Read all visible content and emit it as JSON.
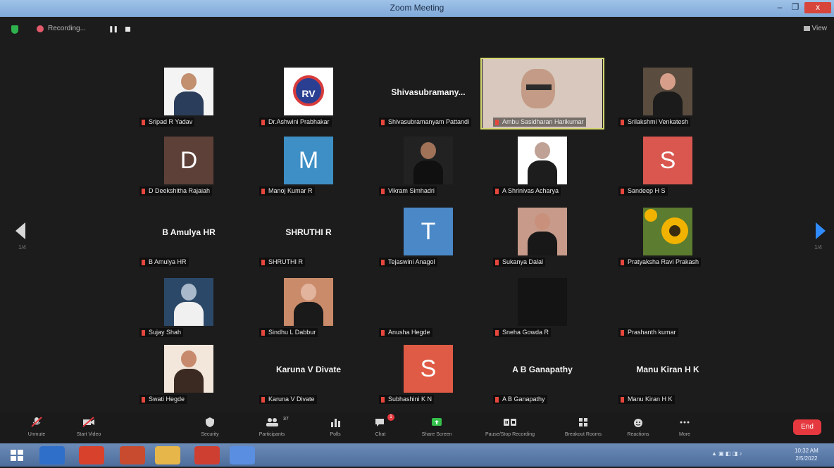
{
  "window": {
    "title": "Zoom Meeting",
    "min": "–",
    "max": "❐",
    "close": "x"
  },
  "topbar": {
    "recording_label": "Recording...",
    "pause_glyph": "❚❚",
    "view_label": "View"
  },
  "pager": {
    "left_page": "1/4",
    "right_page": "1/4"
  },
  "participants": [
    {
      "id": "p1",
      "caption": "Sripad R Yadav",
      "type": "photo",
      "palette": [
        "#f4f4f4",
        "#2a3d5a",
        "#c28f6f"
      ]
    },
    {
      "id": "p2",
      "caption": "Dr.Ashwini Prabhakar",
      "type": "logo",
      "logo_text": "RV",
      "palette": [
        "#ffffff",
        "#2b3f92",
        "#d83b3b"
      ]
    },
    {
      "id": "p3",
      "caption": "Shivasubramanyam Pattandi",
      "type": "name",
      "display": "Shivasubramany..."
    },
    {
      "id": "p4",
      "caption": "Ambu Sasidharan Harikumar",
      "type": "webcam",
      "active": true,
      "palette": [
        "#d8c8bd",
        "#2b2b2b",
        "#c39b86"
      ]
    },
    {
      "id": "p5",
      "caption": "Srilakshmi Venkatesh",
      "type": "photo",
      "palette": [
        "#5a4c3e",
        "#1b1b1b",
        "#d79f8a"
      ]
    },
    {
      "id": "p6",
      "caption": "D Deekshitha Rajaiah",
      "type": "letter",
      "letter": "D",
      "color": "#5d4037"
    },
    {
      "id": "p7",
      "caption": "Manoj Kumar R",
      "type": "letter",
      "letter": "M",
      "color": "#3d8fc5"
    },
    {
      "id": "p8",
      "caption": "Vikram Simhadri",
      "type": "photo",
      "palette": [
        "#222222",
        "#101010",
        "#a07258"
      ]
    },
    {
      "id": "p9",
      "caption": "A Shrinivas Acharya",
      "type": "photo",
      "palette": [
        "#ffffff",
        "#1d1d1d",
        "#bfa196"
      ]
    },
    {
      "id": "p10",
      "caption": "Sandeep H S",
      "type": "letter",
      "letter": "S",
      "color": "#d9574f"
    },
    {
      "id": "p11",
      "caption": "B Amulya HR",
      "type": "name",
      "display": "B Amulya HR"
    },
    {
      "id": "p12",
      "caption": "SHRUTHI R",
      "type": "name",
      "display": "SHRUTHI R"
    },
    {
      "id": "p13",
      "caption": "Tejaswini Anagol",
      "type": "letter",
      "letter": "T",
      "color": "#4a88c7"
    },
    {
      "id": "p14",
      "caption": "Sukanya Dalal",
      "type": "photo",
      "palette": [
        "#c79a8a",
        "#181818",
        "#c9917b"
      ]
    },
    {
      "id": "p15",
      "caption": "Pratyaksha Ravi Prakash",
      "type": "sunflower",
      "palette": [
        "#5c7c2f",
        "#f2b300",
        "#3a2a0f"
      ]
    },
    {
      "id": "p16",
      "caption": "Sujay Shah",
      "type": "photo",
      "palette": [
        "#2c4868",
        "#f0f0f0",
        "#a9b9cb"
      ]
    },
    {
      "id": "p17",
      "caption": "Sindhu L Dabbur",
      "type": "photo",
      "palette": [
        "#ca8b6a",
        "#1a1a1a",
        "#e3b49d"
      ]
    },
    {
      "id": "p18",
      "caption": "Anusha Hegde",
      "type": "blank"
    },
    {
      "id": "p19",
      "caption": "Sneha Gowda R",
      "type": "dark",
      "palette": [
        "#141414"
      ]
    },
    {
      "id": "p20",
      "caption": "Prashanth kumar",
      "type": "blank"
    },
    {
      "id": "p21",
      "caption": "Swati Hegde",
      "type": "photo",
      "palette": [
        "#f3e7db",
        "#3a2a22",
        "#c88a6d"
      ]
    },
    {
      "id": "p22",
      "caption": "Karuna V Divate",
      "type": "name",
      "display": "Karuna V Divate"
    },
    {
      "id": "p23",
      "caption": "Subhashini K N",
      "type": "letter",
      "letter": "S",
      "color": "#e05b45"
    },
    {
      "id": "p24",
      "caption": "A B Ganapathy",
      "type": "name",
      "display": "A B Ganapathy"
    },
    {
      "id": "p25",
      "caption": "Manu Kiran H K",
      "type": "name",
      "display": "Manu Kiran H K"
    }
  ],
  "controls": {
    "unmute": "Unmute",
    "start_video": "Start Video",
    "security": "Security",
    "participants": "Participants",
    "participants_count": "37",
    "polls": "Polls",
    "chat": "Chat",
    "chat_badge": "1",
    "share_screen": "Share Screen",
    "pause_stop_recording": "Pause/Stop Recording",
    "breakout_rooms": "Breakout Rooms",
    "reactions": "Reactions",
    "more": "More",
    "end": "End"
  },
  "taskbar": {
    "clock_time": "10:32 AM",
    "clock_date": "2/5/2022",
    "apps": [
      "windows-start",
      "outlook",
      "chrome",
      "powerpoint",
      "file-explorer",
      "chrome-profile",
      "zoom"
    ]
  }
}
